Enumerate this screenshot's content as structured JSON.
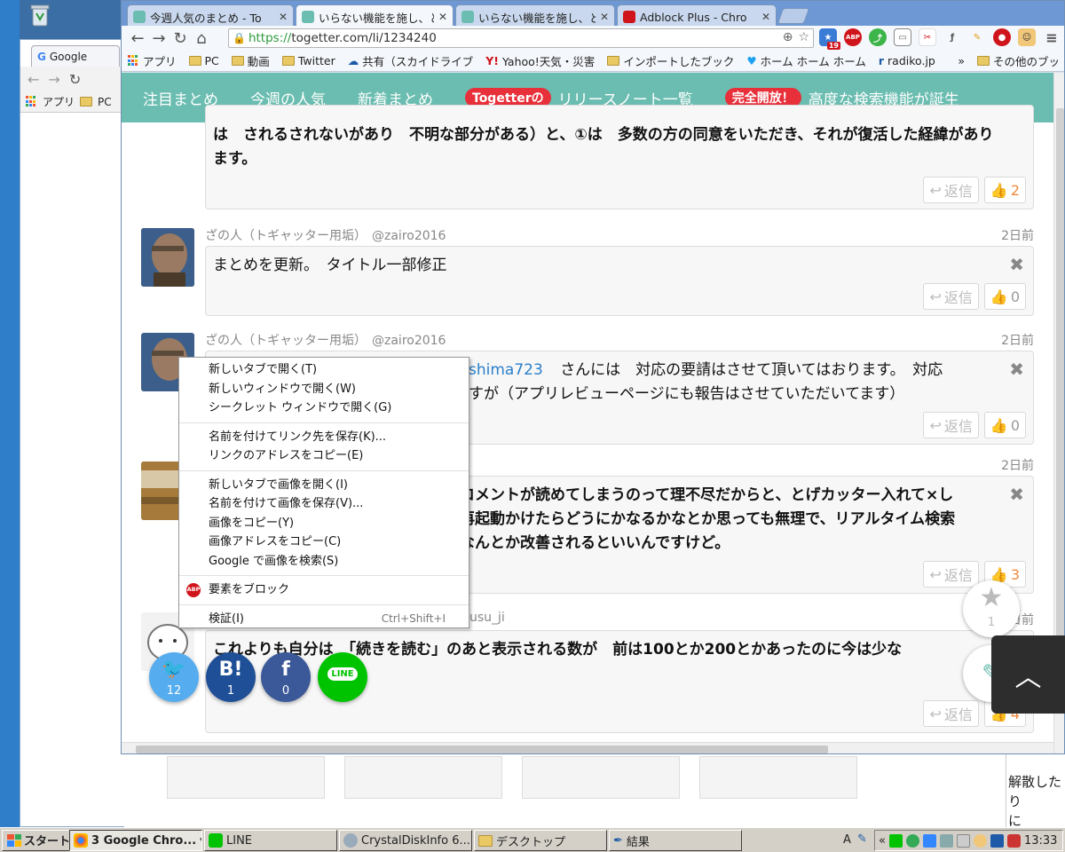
{
  "browser": {
    "tabs": [
      {
        "title": "今週人気のまとめ - To",
        "active": false
      },
      {
        "title": "いらない機能を施し、と",
        "active": true
      },
      {
        "title": "いらない機能を施し、と",
        "active": false
      },
      {
        "title": "Adblock Plus - Chro",
        "active": false
      }
    ],
    "url_scheme": "https://",
    "url_rest": "togetter.com/li/1234240",
    "bookmarks": [
      "アプリ",
      "PC",
      "動画",
      "Twitter",
      "共有（スカイドライブ",
      "Yahoo!天気・災害",
      "インポートしたブック",
      "ホーム ホーム ホーム",
      "radiko.jp",
      "その他のブッ"
    ],
    "ext_badge": "19",
    "ext_abp": "ABP"
  },
  "background_window": {
    "tab_title": "Google",
    "bookmarks": [
      "アプリ",
      "PC"
    ],
    "right_text": [
      "解散したり",
      "に"
    ]
  },
  "site_nav": {
    "items": [
      "注目まとめ",
      "今週の人気",
      "新着まとめ"
    ],
    "togetter_pill": "Togetterの",
    "release_notes": "リリースノート一覧",
    "open_pill": "完全開放！",
    "search_feature": "高度な検索機能が誕生"
  },
  "comments": [
    {
      "text": "は　されるされないがあり　不明な部分がある）と、①は　多数の方の同意をいただき、それが復活した経緯があります。",
      "reply": "返信",
      "likes": "2",
      "liked": true
    },
    {
      "author": "ざの人（トギャッター用垢）",
      "handle": "@zairo2016",
      "time": "2日前",
      "text": "まとめを更新。　タイトル一部修正",
      "reply": "返信",
      "likes": "0"
    },
    {
      "author": "ざの人（トギャッター用垢）",
      "handle": "@zairo2016",
      "time": "2日前",
      "text_link": "shima723",
      "text_line1": "さんには　対応の要請はさせて頂いてはおります。　対応",
      "text_line2": "すが（アプリレビューページにも報告はさせていただいてます）",
      "reply": "返信",
      "likes": "0"
    },
    {
      "time": "2日前",
      "text_line1": "コメントが読めてしまうのって理不尽だからと、とげカッター入れて×し",
      "text_line2": "再起動かけたらどうにかなるかなとか思っても無理で、リアルタイム検索",
      "text_line3": "なんとか改善されるといいんですけど。",
      "reply": "返信",
      "likes": "3"
    },
    {
      "handle": "usu_ji",
      "time": "2日前",
      "text": "これよりも自分は　「続きを読む」のあと表示される数が　前は100とか200とかあったのに今は少な",
      "reply": "返信",
      "likes": "4"
    }
  ],
  "share": {
    "twitter": "12",
    "hatena_label": "B!",
    "hatena": "1",
    "facebook_label": "f",
    "facebook": "0",
    "line_label": "LINE"
  },
  "favorite_count": "1",
  "context_menu": {
    "items": [
      "新しいタブで開く(T)",
      "新しいウィンドウで開く(W)",
      "シークレット ウィンドウで開く(G)",
      "名前を付けてリンク先を保存(K)...",
      "リンクのアドレスをコピー(E)",
      "新しいタブで画像を開く(I)",
      "名前を付けて画像を保存(V)...",
      "画像をコピー(Y)",
      "画像アドレスをコピー(C)",
      "Google で画像を検索(S)",
      "要素をブロック",
      "検証(I)"
    ],
    "inspect_shortcut": "Ctrl+Shift+I"
  },
  "taskbar": {
    "start": "スタート",
    "tasks": [
      "3 Google Chro...",
      "LINE",
      "CrystalDiskInfo 6....",
      "デスクトップ",
      "結果"
    ],
    "tray_prefix": "A",
    "clock": "13:33"
  }
}
